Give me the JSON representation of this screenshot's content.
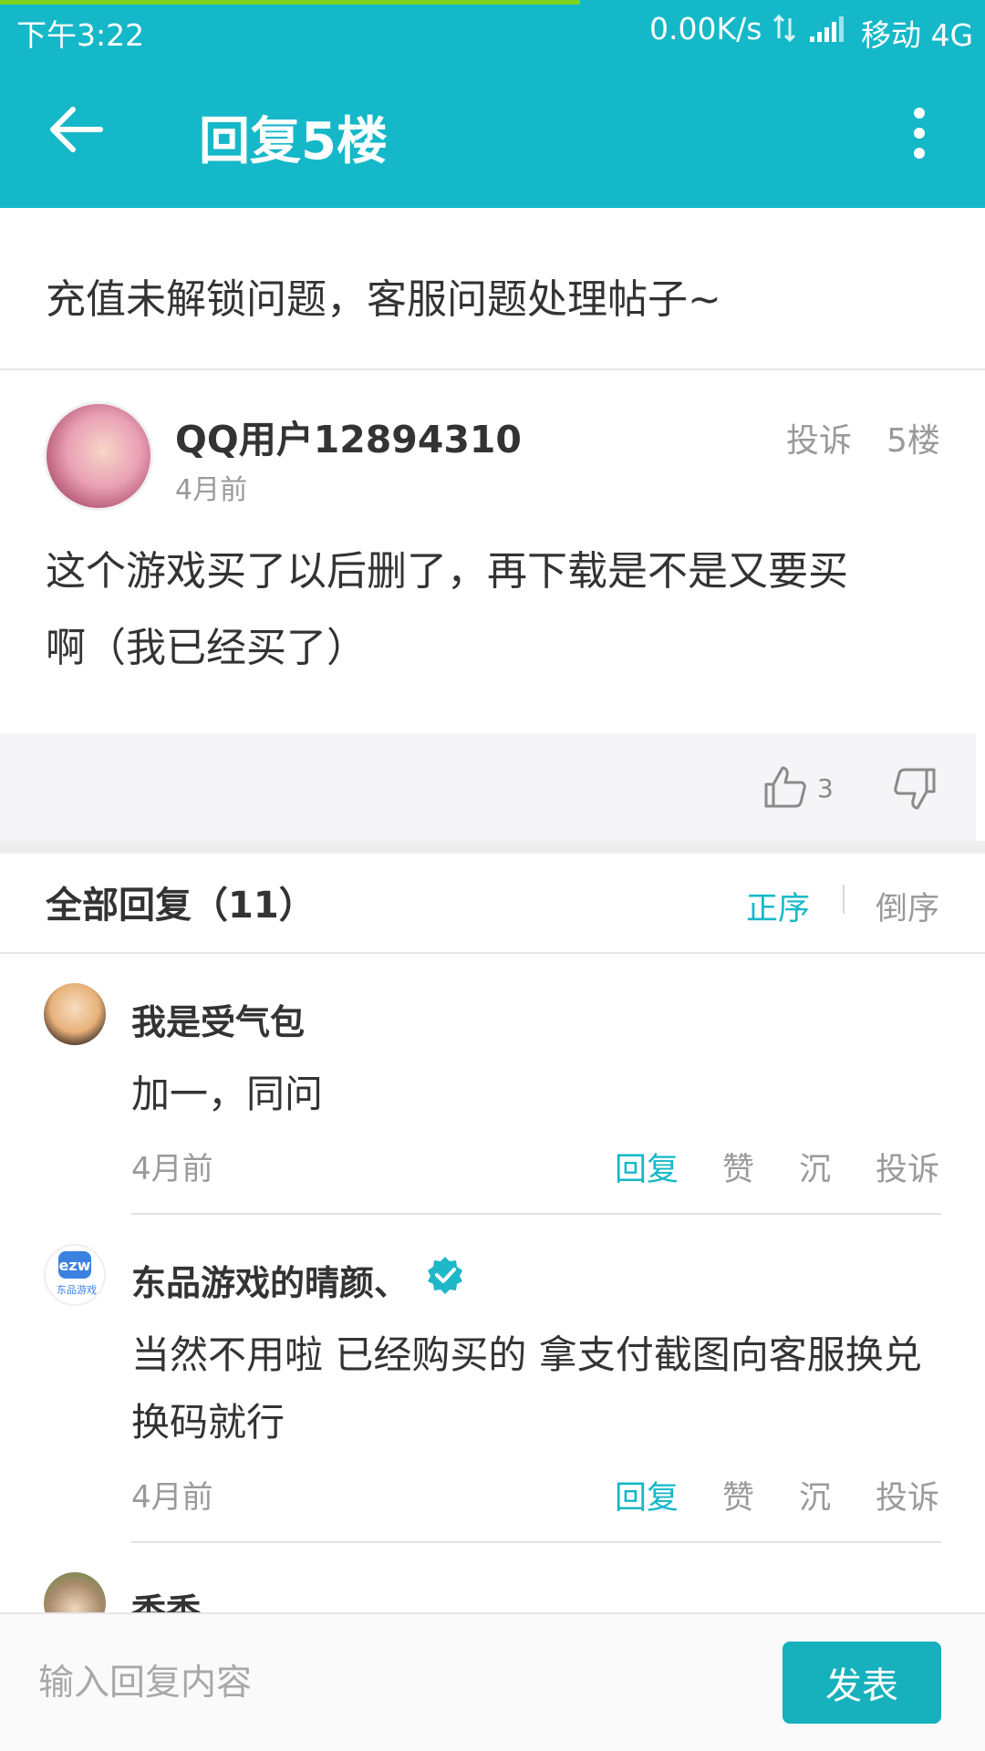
{
  "status_bar": {
    "time": "下午3:22",
    "network_speed": "0.00K/s",
    "carrier": "移动 4G",
    "load_progress": 0.59
  },
  "header": {
    "title": "回复5楼",
    "back_icon": "arrow-left-icon",
    "menu_icon": "more-vertical-icon"
  },
  "topic": {
    "title": "充值未解锁问题，客服问题处理帖子~"
  },
  "post": {
    "username": "QQ用户12894310",
    "time": "4月前",
    "report_label": "投诉",
    "floor_label": "5楼",
    "content_lines": [
      "这个游戏买了以后删了，再下载是不是又要买",
      "啊（我已经买了）"
    ],
    "like_count": "3"
  },
  "replies_header": {
    "title": "全部回复（11）",
    "sort_asc_label": "正序",
    "sort_desc_label": "倒序"
  },
  "replies": [
    {
      "name": "我是受气包",
      "lines": [
        "加一，同问"
      ],
      "time": "4月前",
      "actions": [
        "回复",
        "赞",
        "沉",
        "投诉"
      ]
    },
    {
      "name": "东品游戏的晴颜、",
      "verified": true,
      "avatar_text": "ezw",
      "avatar_caption": "东品游戏",
      "lines": [
        "当然不用啦 已经购买的 拿支付截图向客服换兑",
        "换码就行"
      ],
      "time": "4月前",
      "actions": [
        "回复",
        "赞",
        "沉",
        "投诉"
      ]
    },
    {
      "name": "香香",
      "lines": [],
      "time": "",
      "actions": []
    }
  ],
  "composer": {
    "placeholder": "输入回复内容",
    "send_label": "发表"
  },
  "colors": {
    "accent": "#15b8c8",
    "progress": "#7ed321",
    "send_button": "#17b0bd"
  }
}
